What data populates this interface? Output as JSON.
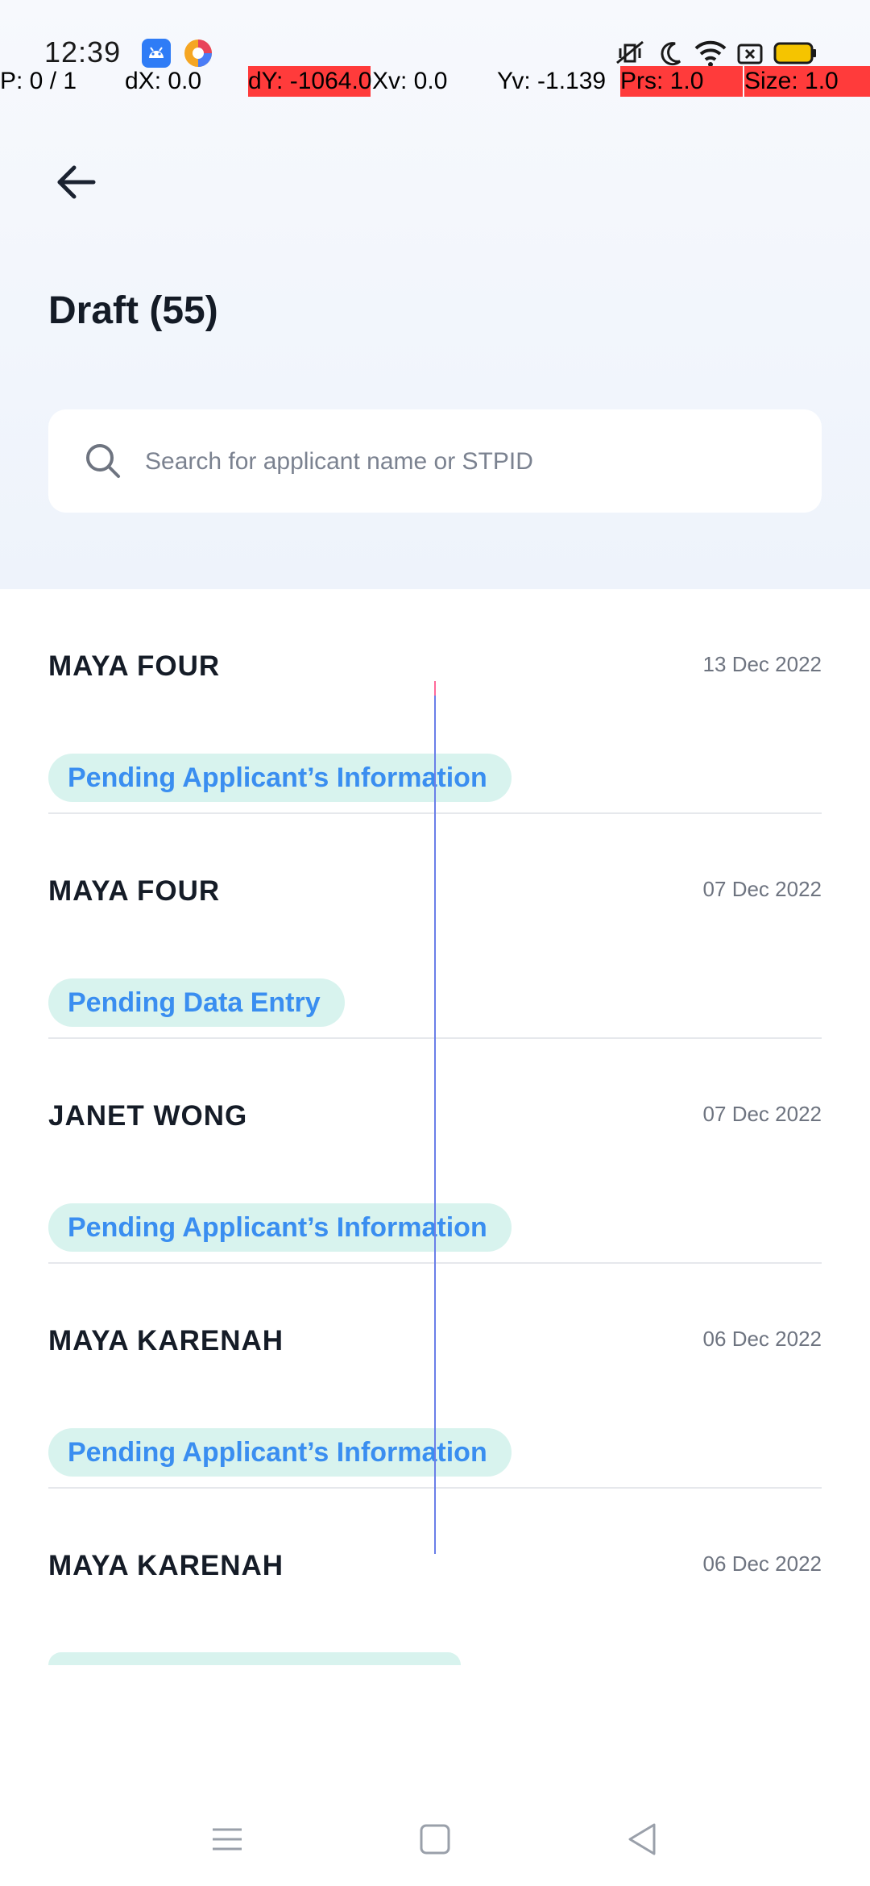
{
  "status_bar": {
    "time": "12:39",
    "icons": [
      "android-debug-icon",
      "browser-app-icon",
      "vibrate-mute-icon",
      "moon-icon",
      "wifi-icon",
      "screenshot-icon",
      "battery-icon"
    ]
  },
  "debug_overlay": {
    "pointer": "P: 0 / 1",
    "dx": "dX: 0.0",
    "dy": "dY: -1064.0",
    "xv": "Xv: 0.0",
    "yv": "Yv: -1.139",
    "prs": "Prs: 1.0",
    "size": "Size: 1.0",
    "highlight_color": "#ff3b3b"
  },
  "header": {
    "back_icon": "arrow-left-icon",
    "title": "Draft (55)"
  },
  "search": {
    "placeholder": "Search for applicant name or STPID",
    "value": ""
  },
  "drafts": [
    {
      "name": "MAYA FOUR",
      "date": "13 Dec 2022",
      "status": "Pending Applicant’s Information"
    },
    {
      "name": "MAYA FOUR",
      "date": "07 Dec 2022",
      "status": "Pending Data Entry"
    },
    {
      "name": "JANET WONG",
      "date": "07 Dec 2022",
      "status": "Pending Applicant’s Information"
    },
    {
      "name": "MAYA KARENAH",
      "date": "06 Dec 2022",
      "status": "Pending Applicant’s Information"
    },
    {
      "name": "MAYA KARENAH",
      "date": "06 Dec 2022",
      "status": ""
    }
  ],
  "colors": {
    "badge_bg": "#d8f3ee",
    "badge_text": "#3a8ef0",
    "header_bg": "#eef3fb"
  },
  "nav_bar": {
    "icons": [
      "menu-icon",
      "home-square-icon",
      "back-triangle-icon"
    ]
  }
}
